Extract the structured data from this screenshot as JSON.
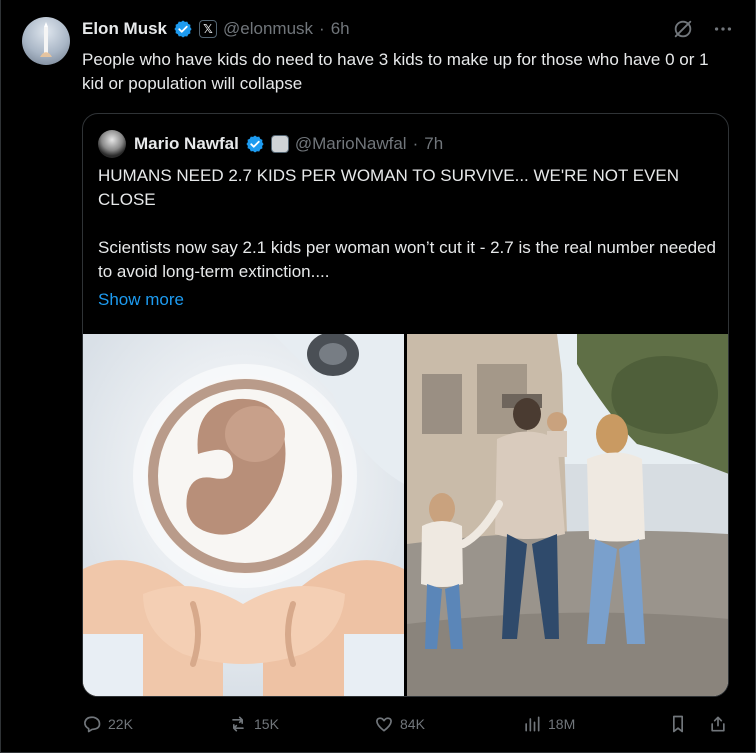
{
  "author": {
    "name": "Elon Musk",
    "handle": "@elonmusk",
    "separator": "·",
    "time": "6h"
  },
  "tweet": {
    "text": "People who have kids do need to have 3 kids to make up for those who have 0 or 1 kid or population will collapse"
  },
  "quote": {
    "name": "Mario Nawfal",
    "handle": "@MarioNawfal",
    "separator": "·",
    "time": "7h",
    "text": "HUMANS NEED 2.7 KIDS PER WOMAN TO SURVIVE... WE'RE NOT EVEN CLOSE\n\nScientists now say 2.1 kids per woman won’t cut it - 2.7 is the real number needed to avoid long-term extinction....",
    "show_more": "Show more"
  },
  "actions": {
    "replies": "22K",
    "reposts": "15K",
    "likes": "84K",
    "views": "18M"
  },
  "colors": {
    "background": "#000000",
    "text": "#e7e9ea",
    "muted": "#71767b",
    "border": "#2f3336",
    "accent": "#1d9bf0"
  },
  "icons": [
    "grok-icon",
    "more-icon",
    "verified-icon",
    "affiliate-badge-icon",
    "reply-icon",
    "repost-icon",
    "like-icon",
    "views-icon",
    "bookmark-icon",
    "share-icon"
  ]
}
